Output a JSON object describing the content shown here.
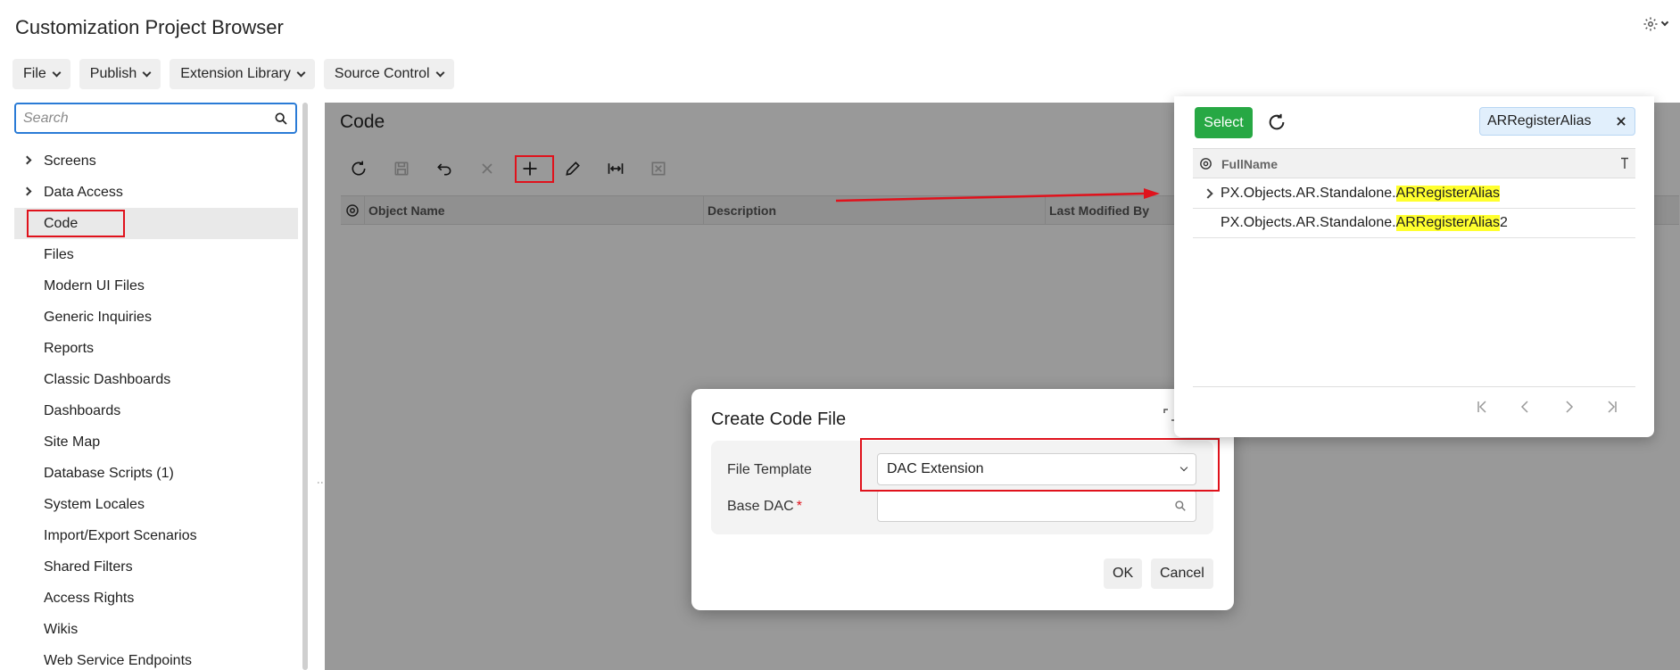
{
  "app": {
    "title": "Customization Project Browser"
  },
  "menubar": [
    {
      "label": "File"
    },
    {
      "label": "Publish"
    },
    {
      "label": "Extension Library"
    },
    {
      "label": "Source Control"
    }
  ],
  "sidebar": {
    "search_placeholder": "Search",
    "items": [
      {
        "label": "Screens",
        "expandable": true
      },
      {
        "label": "Data Access",
        "expandable": true
      },
      {
        "label": "Code",
        "selected": true
      },
      {
        "label": "Files"
      },
      {
        "label": "Modern UI Files"
      },
      {
        "label": "Generic Inquiries"
      },
      {
        "label": "Reports"
      },
      {
        "label": "Classic Dashboards"
      },
      {
        "label": "Dashboards"
      },
      {
        "label": "Site Map"
      },
      {
        "label": "Database Scripts (1)"
      },
      {
        "label": "System Locales"
      },
      {
        "label": "Import/Export Scenarios"
      },
      {
        "label": "Shared Filters"
      },
      {
        "label": "Access Rights"
      },
      {
        "label": "Wikis"
      },
      {
        "label": "Web Service Endpoints"
      }
    ]
  },
  "main": {
    "title": "Code",
    "toolbar": [
      "refresh-icon",
      "save-icon",
      "undo-icon",
      "delete-icon",
      "add-icon",
      "edit-icon",
      "fit-columns-icon",
      "export-icon"
    ],
    "columns": [
      "Object Name",
      "Description",
      "Last Modified By"
    ]
  },
  "dialog": {
    "title": "Create Code File",
    "file_template_label": "File Template",
    "file_template_value": "DAC Extension",
    "base_dac_label": "Base DAC",
    "base_dac_required": "*",
    "base_dac_value": "",
    "ok_label": "OK",
    "cancel_label": "Cancel"
  },
  "lookup": {
    "select_label": "Select",
    "search_value": "ARRegisterAlias",
    "column_header": "FullName",
    "rows": [
      {
        "prefix": "PX.Objects.AR.Standalone.",
        "match": "ARRegisterAlias",
        "suffix": ""
      },
      {
        "prefix": "PX.Objects.AR.Standalone.",
        "match": "ARRegisterAlias",
        "suffix": "2"
      }
    ]
  },
  "colors": {
    "accent_blue": "#2a7bd6",
    "select_green": "#27a844",
    "annotation_red": "#e0121c",
    "highlight_yellow": "#ffff2e"
  }
}
